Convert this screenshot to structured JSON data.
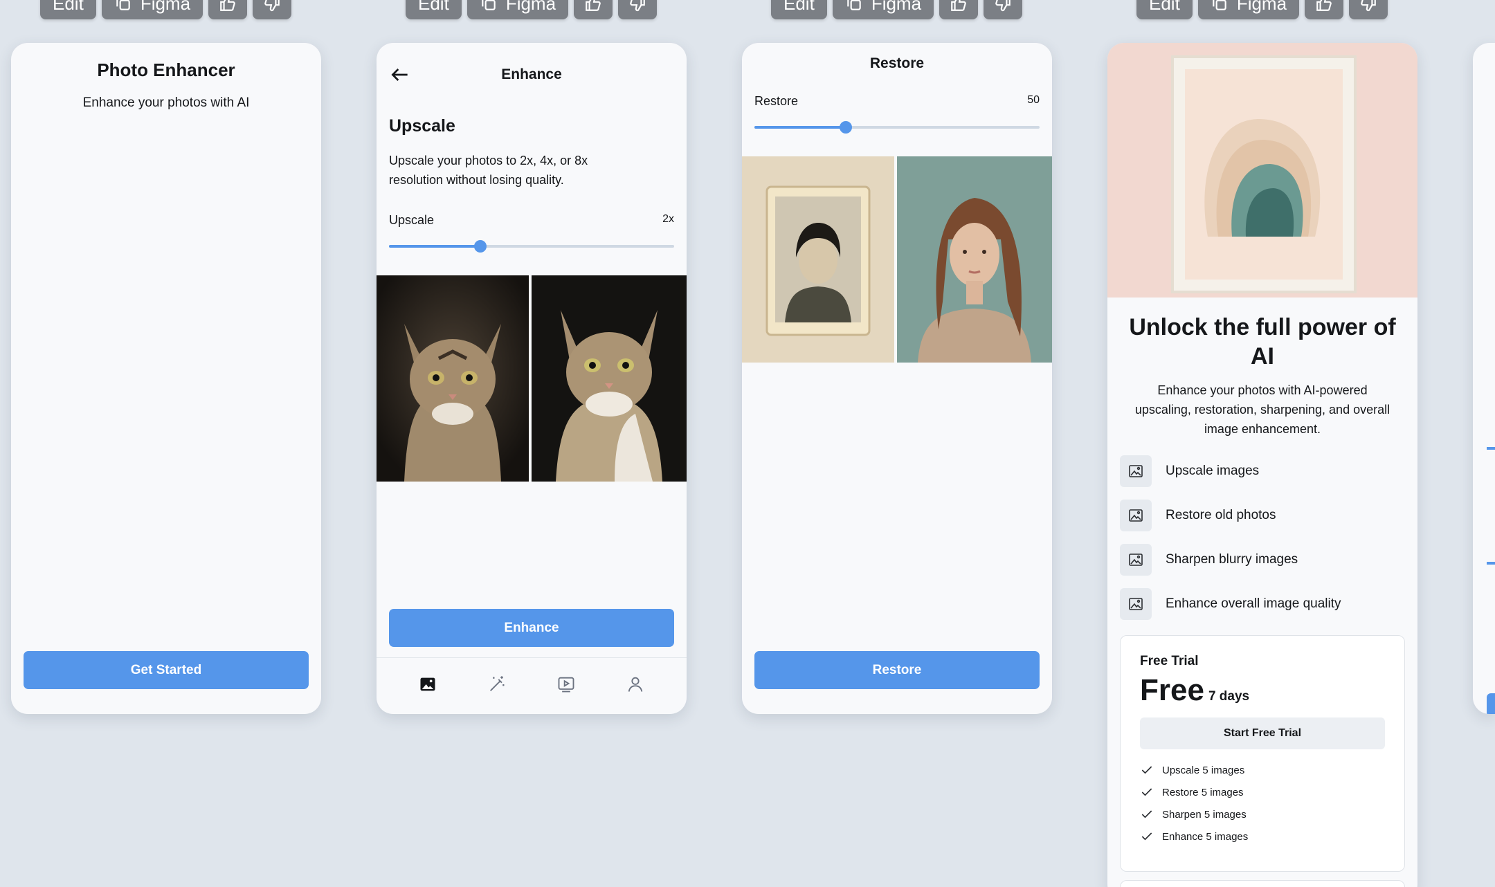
{
  "toolbar": {
    "edit": "Edit",
    "figma": "Figma"
  },
  "welcome": {
    "title": "Photo Enhancer",
    "subtitle": "Enhance your photos with AI",
    "cta": "Get Started"
  },
  "enhance": {
    "header": "Enhance",
    "section_title": "Upscale",
    "description": "Upscale your photos to 2x, 4x, or 8x resolution without losing quality.",
    "slider_label": "Upscale",
    "slider_value": "2x",
    "slider_level": 0.32,
    "cta": "Enhance",
    "nav": [
      "image-icon",
      "magic-wand-icon",
      "video-icon",
      "profile-icon"
    ]
  },
  "restore": {
    "header": "Restore",
    "slider_label": "Restore",
    "slider_value": "50",
    "slider_level": 0.32,
    "cta": "Restore"
  },
  "paywall": {
    "title": "Unlock the full power of AI",
    "description": "Enhance your photos with AI-powered upscaling, restoration, sharpening, and overall image enhancement.",
    "features": [
      "Upscale images",
      "Restore old photos",
      "Sharpen blurry images",
      "Enhance overall image quality"
    ],
    "plan": {
      "label": "Free Trial",
      "price": "Free",
      "period": "7 days",
      "cta": "Start Free Trial",
      "items": [
        "Upscale 5 images",
        "Restore 5 images",
        "Sharpen 5 images",
        "Enhance 5 images"
      ]
    }
  },
  "colors": {
    "accent": "#5596ea",
    "background": "#dfe5ec",
    "card": "#f8f9fb"
  }
}
